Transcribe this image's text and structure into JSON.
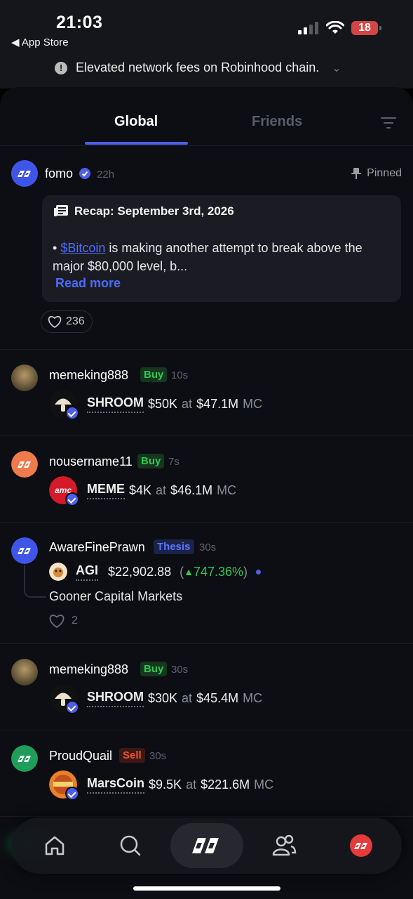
{
  "status_bar": {
    "time": "21:03",
    "back_app": "◀ App Store",
    "battery": "18",
    "icons": [
      "signal-icon",
      "wifi-icon",
      "battery-icon"
    ]
  },
  "banner": {
    "text": "Elevated network fees on Robinhood chain.",
    "icon": "info-icon"
  },
  "tabs": [
    {
      "label": "Global",
      "active": true
    },
    {
      "label": "Friends",
      "active": false
    }
  ],
  "colors": {
    "accent": "#4d5ee8",
    "buy": "#2fc853",
    "sell": "#f0522f",
    "thesis": "#5a74ff",
    "background": "#0d0e13"
  },
  "pinned_post": {
    "username": "fomo",
    "time": "22h",
    "pinned_label": "Pinned",
    "recap_title": "Recap: September 3rd, 2026",
    "body_bullet": "•",
    "body_link": "$Bitcoin",
    "body_text": " is making another attempt to break above the major $80,000 level, b...",
    "read_more": "Read more",
    "likes": "236"
  },
  "feed": [
    {
      "username": "memeking888",
      "tag": "Buy",
      "time": "10s",
      "symbol": "SHROOM",
      "amount": "$50K",
      "at": "at",
      "mc": "$47.1M",
      "mc_label": "MC"
    },
    {
      "username": "nousername11",
      "tag": "Buy",
      "time": "7s",
      "symbol": "MEME",
      "amount": "$4K",
      "at": "at",
      "mc": "$46.1M",
      "mc_label": "MC"
    },
    {
      "username": "AwareFinePrawn",
      "tag": "Thesis",
      "time": "30s",
      "symbol": "AGI",
      "price": "$22,902.88",
      "change_open": "(",
      "change_arrow": "▲",
      "change": "747.36%",
      "change_close": ")",
      "text": "Gooner Capital Markets",
      "likes": "2"
    },
    {
      "username": "memeking888",
      "tag": "Buy",
      "time": "30s",
      "symbol": "SHROOM",
      "amount": "$30K",
      "at": "at",
      "mc": "$45.4M",
      "mc_label": "MC"
    },
    {
      "username": "ProudQuail",
      "tag": "Sell",
      "time": "30s",
      "symbol": "MarsCoin",
      "amount": "$9.5K",
      "at": "at",
      "mc": "$221.6M",
      "mc_label": "MC"
    }
  ],
  "nav": [
    "home-icon",
    "search-icon",
    "fomo-logo-icon",
    "friends-icon",
    "profile-icon"
  ]
}
